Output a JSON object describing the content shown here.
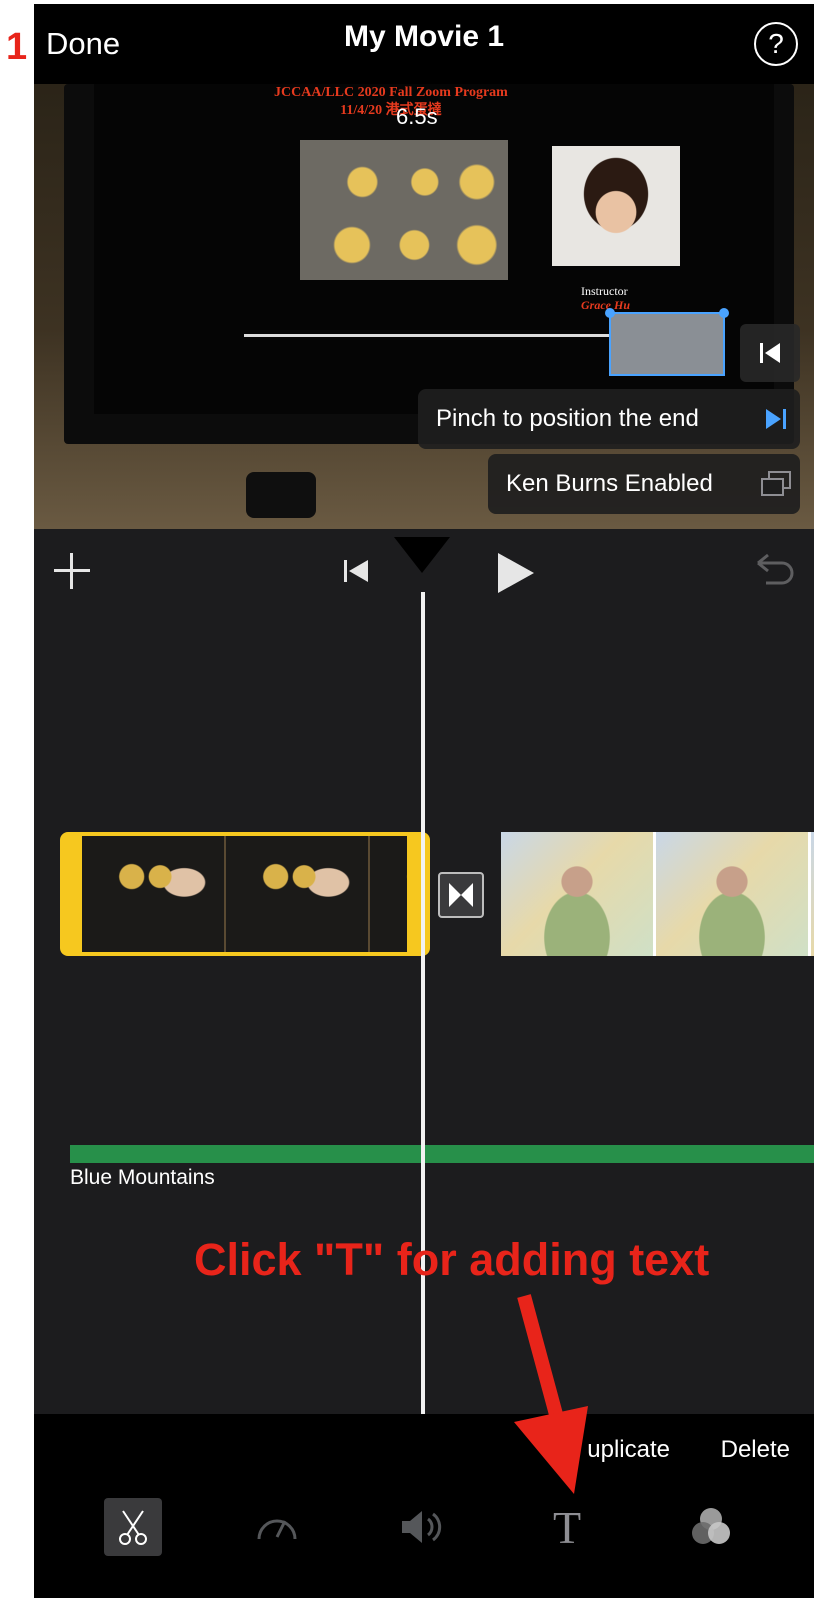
{
  "annotation": {
    "step_number": "1",
    "instruction": "Click \"T\" for adding text"
  },
  "header": {
    "done_label": "Done",
    "title": "My Movie 1",
    "help_label": "?"
  },
  "preview": {
    "video_title_line1": "JCCAA/LLC 2020 Fall Zoom Program",
    "video_title_line2": "11/4/20 港式蛋撻",
    "duration": "6.5s",
    "instructor_label": "Instructor",
    "instructor_name": "Grace Hu",
    "hints": [
      {
        "text": "Pinch to position the end",
        "icon": "skip-end-icon"
      },
      {
        "text": "Ken Burns Enabled",
        "icon": "ken-burns-icon"
      }
    ]
  },
  "timeline": {
    "audio_track_label": "Blue Mountains"
  },
  "toolbar": {
    "duplicate_label": "uplicate",
    "delete_label": "Delete",
    "tools": [
      {
        "name": "scissors-icon",
        "active": true
      },
      {
        "name": "speed-icon",
        "active": false
      },
      {
        "name": "volume-icon",
        "active": false
      },
      {
        "name": "text-tool",
        "glyph": "T",
        "active": false
      },
      {
        "name": "filters-icon",
        "active": false
      }
    ]
  },
  "colors": {
    "annotation_red": "#e8241a",
    "clip_selected_yellow": "#f6c81f",
    "audio_green": "#27904a",
    "accent_blue": "#4aa3ff"
  }
}
